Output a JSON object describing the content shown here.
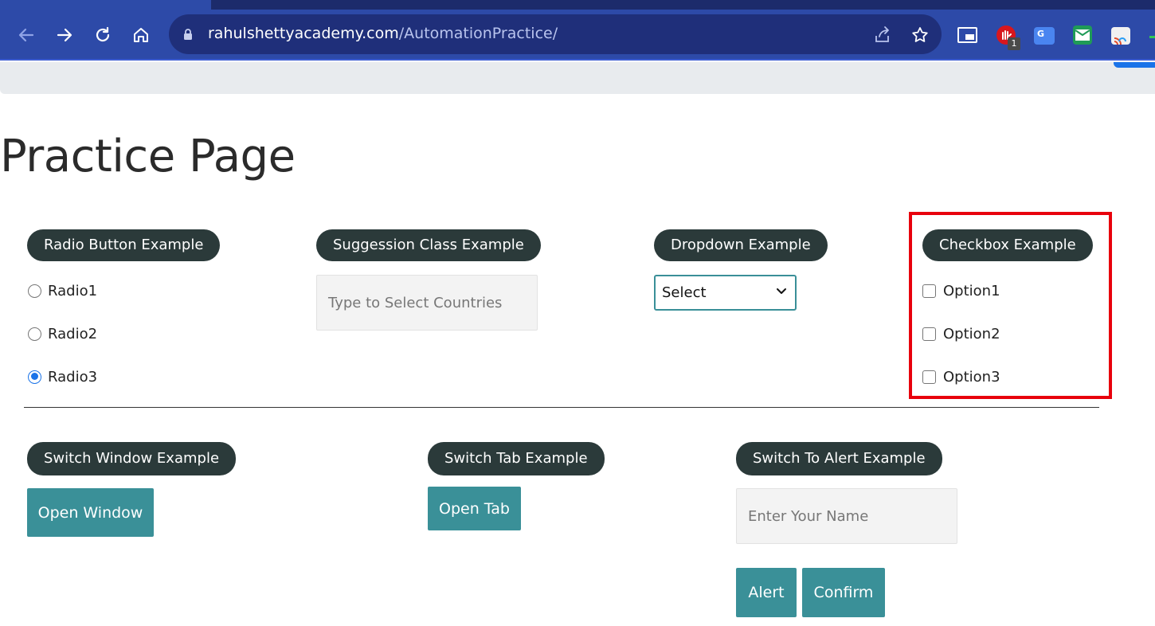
{
  "browser": {
    "url_host": "rahulshettyacademy.com",
    "url_path": "/AutomationPractice/",
    "extension_badge": "1"
  },
  "page": {
    "title": "Practice Page"
  },
  "radio_section": {
    "legend": "Radio Button Example",
    "options": [
      {
        "label": "Radio1",
        "checked": false
      },
      {
        "label": "Radio2",
        "checked": false
      },
      {
        "label": "Radio3",
        "checked": true
      }
    ]
  },
  "suggestion_section": {
    "legend": "Suggession Class Example",
    "placeholder": "Type to Select Countries"
  },
  "dropdown_section": {
    "legend": "Dropdown Example",
    "selected": "Select"
  },
  "checkbox_section": {
    "legend": "Checkbox Example",
    "options": [
      {
        "label": "Option1",
        "checked": false
      },
      {
        "label": "Option2",
        "checked": false
      },
      {
        "label": "Option3",
        "checked": false
      }
    ],
    "highlight_color": "#e8000c"
  },
  "switch_window_section": {
    "legend": "Switch Window Example",
    "button": "Open Window"
  },
  "switch_tab_section": {
    "legend": "Switch Tab Example",
    "button": "Open Tab"
  },
  "alert_section": {
    "legend": "Switch To Alert Example",
    "placeholder": "Enter Your Name",
    "alert_button": "Alert",
    "confirm_button": "Confirm"
  },
  "colors": {
    "legend_bg": "#2b3a3a",
    "button_bg": "#3a9098",
    "chrome_bg": "#2d4aa8"
  }
}
